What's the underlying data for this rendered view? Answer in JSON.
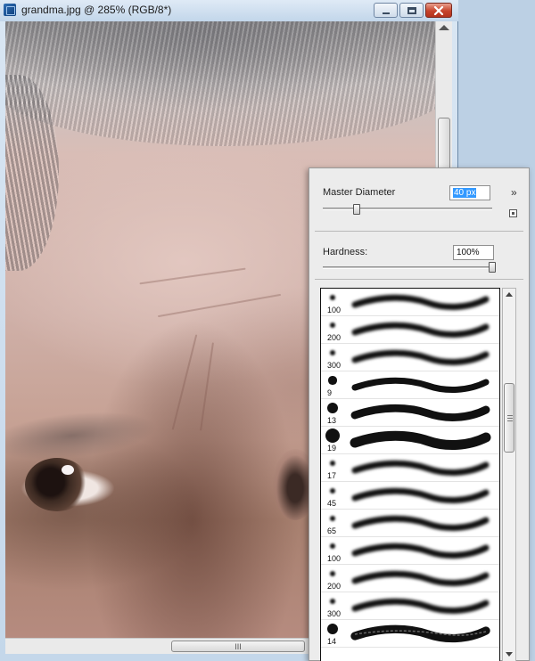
{
  "window": {
    "title": "grandma.jpg @ 285% (RGB/8*)",
    "scroll_grip": "III"
  },
  "brush_picker": {
    "master_diameter_label": "Master Diameter",
    "master_diameter_value": "40 px",
    "master_diameter_fraction": 0.2,
    "hardness_label": "Hardness:",
    "hardness_value": "100%",
    "hardness_fraction": 1.0,
    "menu_glyph": "»",
    "presets": [
      {
        "size": "100",
        "soft": true
      },
      {
        "size": "200",
        "soft": true
      },
      {
        "size": "300",
        "soft": true
      },
      {
        "size": "9",
        "soft": false
      },
      {
        "size": "13",
        "soft": false
      },
      {
        "size": "19",
        "soft": false
      },
      {
        "size": "17",
        "soft": true
      },
      {
        "size": "45",
        "soft": true
      },
      {
        "size": "65",
        "soft": true
      },
      {
        "size": "100",
        "soft": true
      },
      {
        "size": "200",
        "soft": true
      },
      {
        "size": "300",
        "soft": true
      },
      {
        "size": "14",
        "soft": false,
        "textured": true
      }
    ]
  }
}
